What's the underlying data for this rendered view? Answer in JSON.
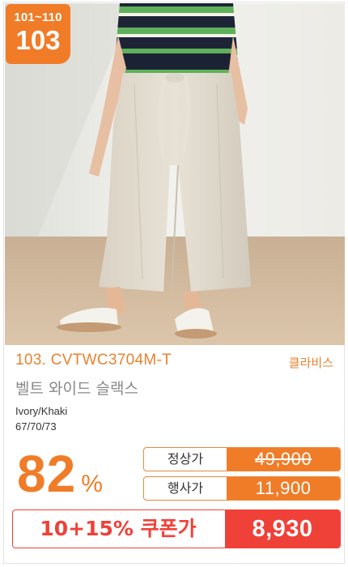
{
  "badge": {
    "range": "101~110",
    "number": "103"
  },
  "product": {
    "code": "103. CVTWC3704M-T",
    "brand": "클라비스",
    "name": "벨트 와이드 슬랙스",
    "color": "Ivory/Khaki",
    "sizes": "67/70/73"
  },
  "discount": {
    "rate": "82",
    "unit": "%"
  },
  "prices": {
    "regular_label": "정상가",
    "regular_value": "49,900",
    "event_label": "행사가",
    "event_value": "11,900",
    "coupon_label": "10+15% 쿠폰가",
    "coupon_value": "8,930"
  },
  "colors": {
    "accent": "#f07c28",
    "coupon": "#ef4138",
    "brand_text": "#e8822f"
  }
}
